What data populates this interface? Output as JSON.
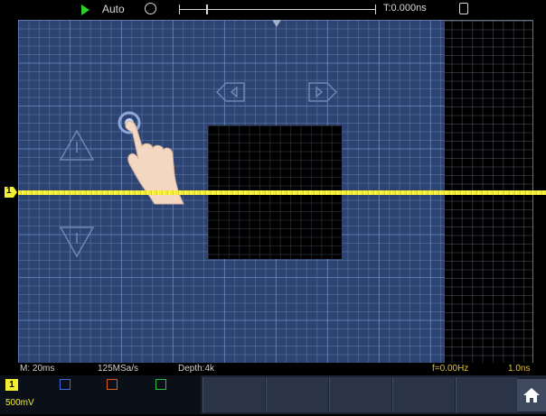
{
  "top_bar": {
    "run_state_icon": "play-triangle-icon",
    "trigger_mode": "Auto",
    "trigger_icon": "trigger-status-icon",
    "time_position": "T:0.000ns",
    "lock_icon": "lock-icon"
  },
  "channel_marker": {
    "label": "1"
  },
  "status_bar": {
    "timebase": "M: 20ms",
    "sample_rate": "125MSa/s",
    "memory_depth": "Depth:4k",
    "frequency": "f=0.00Hz",
    "frequency_hint": "1.0ns"
  },
  "bottom_bar": {
    "ch1_label": "1",
    "ch1_value": "500mV",
    "home_icon": "home-icon"
  },
  "gesture_overlay": {
    "hand_icon": "hand-tap-icon",
    "arrows": [
      "arrow-left-icon",
      "arrow-right-icon",
      "arrow-up-icon",
      "arrow-down-icon"
    ]
  },
  "colors": {
    "ch1": "#f3ee32",
    "ch2": "#3b6de0",
    "ch3": "#e05a1a",
    "ch4": "#2bc03a",
    "overlay": "#2d4472"
  }
}
